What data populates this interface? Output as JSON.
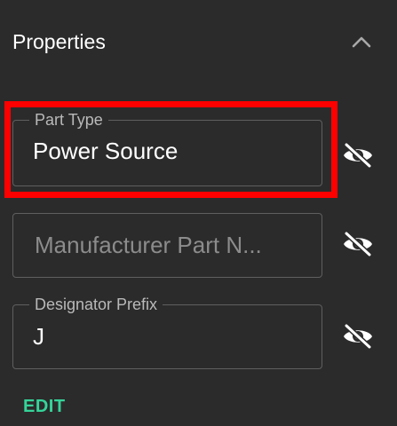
{
  "header": {
    "title": "Properties",
    "collapse_icon": "chevron-up-icon"
  },
  "fields": [
    {
      "label": "Part Type",
      "value": "Power Source",
      "placeholder": "",
      "visibility_icon": "eye-off-icon",
      "highlighted": true
    },
    {
      "label": "",
      "value": "",
      "placeholder": "Manufacturer Part N...",
      "visibility_icon": "eye-off-icon",
      "highlighted": false
    },
    {
      "label": "Designator Prefix",
      "value": "J",
      "placeholder": "",
      "visibility_icon": "eye-off-icon",
      "highlighted": false
    }
  ],
  "actions": {
    "edit_label": "EDIT"
  },
  "colors": {
    "background": "#2b2b2b",
    "field_border": "#5f5f5f",
    "label_text": "#b9b9b9",
    "placeholder_text": "#8c8c8c",
    "accent": "#35d49a",
    "highlight": "#ff0000"
  }
}
